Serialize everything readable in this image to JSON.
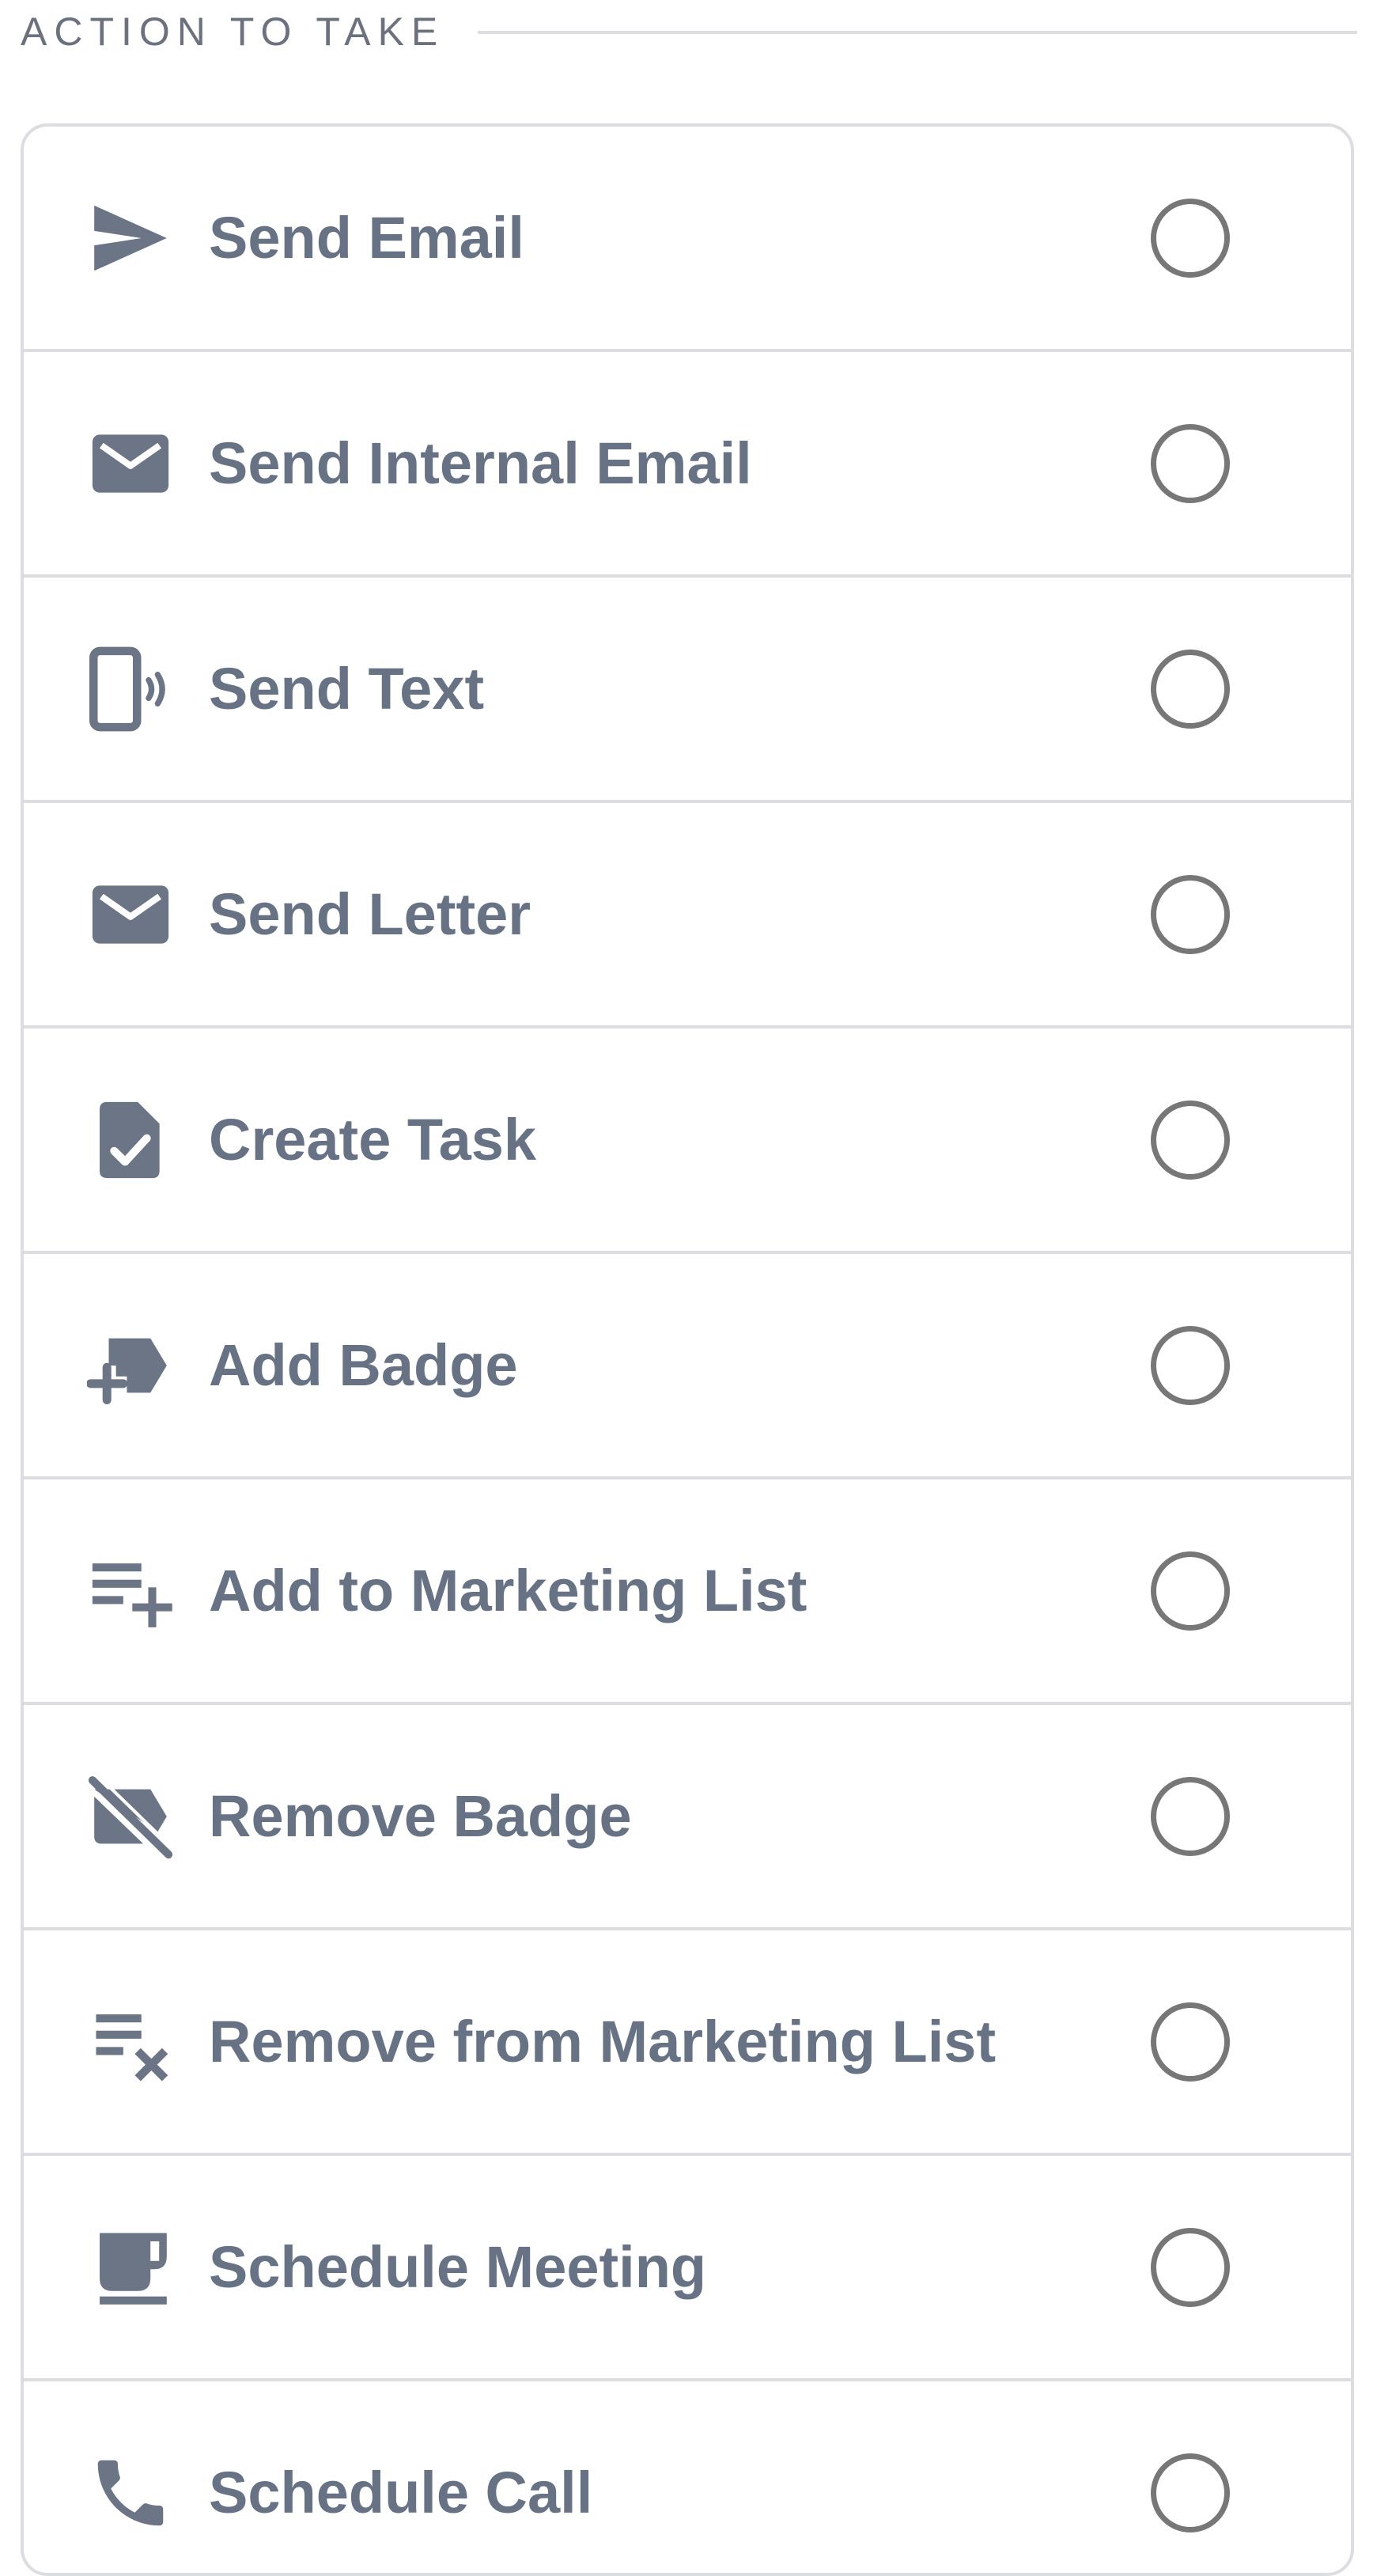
{
  "section": {
    "title": "ACTION TO TAKE"
  },
  "colors": {
    "icon": "#6b7585",
    "label": "#677285",
    "radio_border": "#777777",
    "divider": "#dcdde0"
  },
  "actions": [
    {
      "label": "Send Email",
      "icon": "send-icon",
      "selected": false
    },
    {
      "label": "Send Internal Email",
      "icon": "mail-icon",
      "selected": false
    },
    {
      "label": "Send Text",
      "icon": "phone-text-icon",
      "selected": false
    },
    {
      "label": "Send Letter",
      "icon": "mail-icon",
      "selected": false
    },
    {
      "label": "Create Task",
      "icon": "task-icon",
      "selected": false
    },
    {
      "label": "Add Badge",
      "icon": "add-badge-icon",
      "selected": false
    },
    {
      "label": "Add to Marketing List",
      "icon": "playlist-add-icon",
      "selected": false
    },
    {
      "label": "Remove Badge",
      "icon": "remove-badge-icon",
      "selected": false
    },
    {
      "label": "Remove from Marketing List",
      "icon": "playlist-remove-icon",
      "selected": false
    },
    {
      "label": "Schedule Meeting",
      "icon": "coffee-icon",
      "selected": false
    },
    {
      "label": "Schedule Call",
      "icon": "phone-icon",
      "selected": false
    }
  ]
}
